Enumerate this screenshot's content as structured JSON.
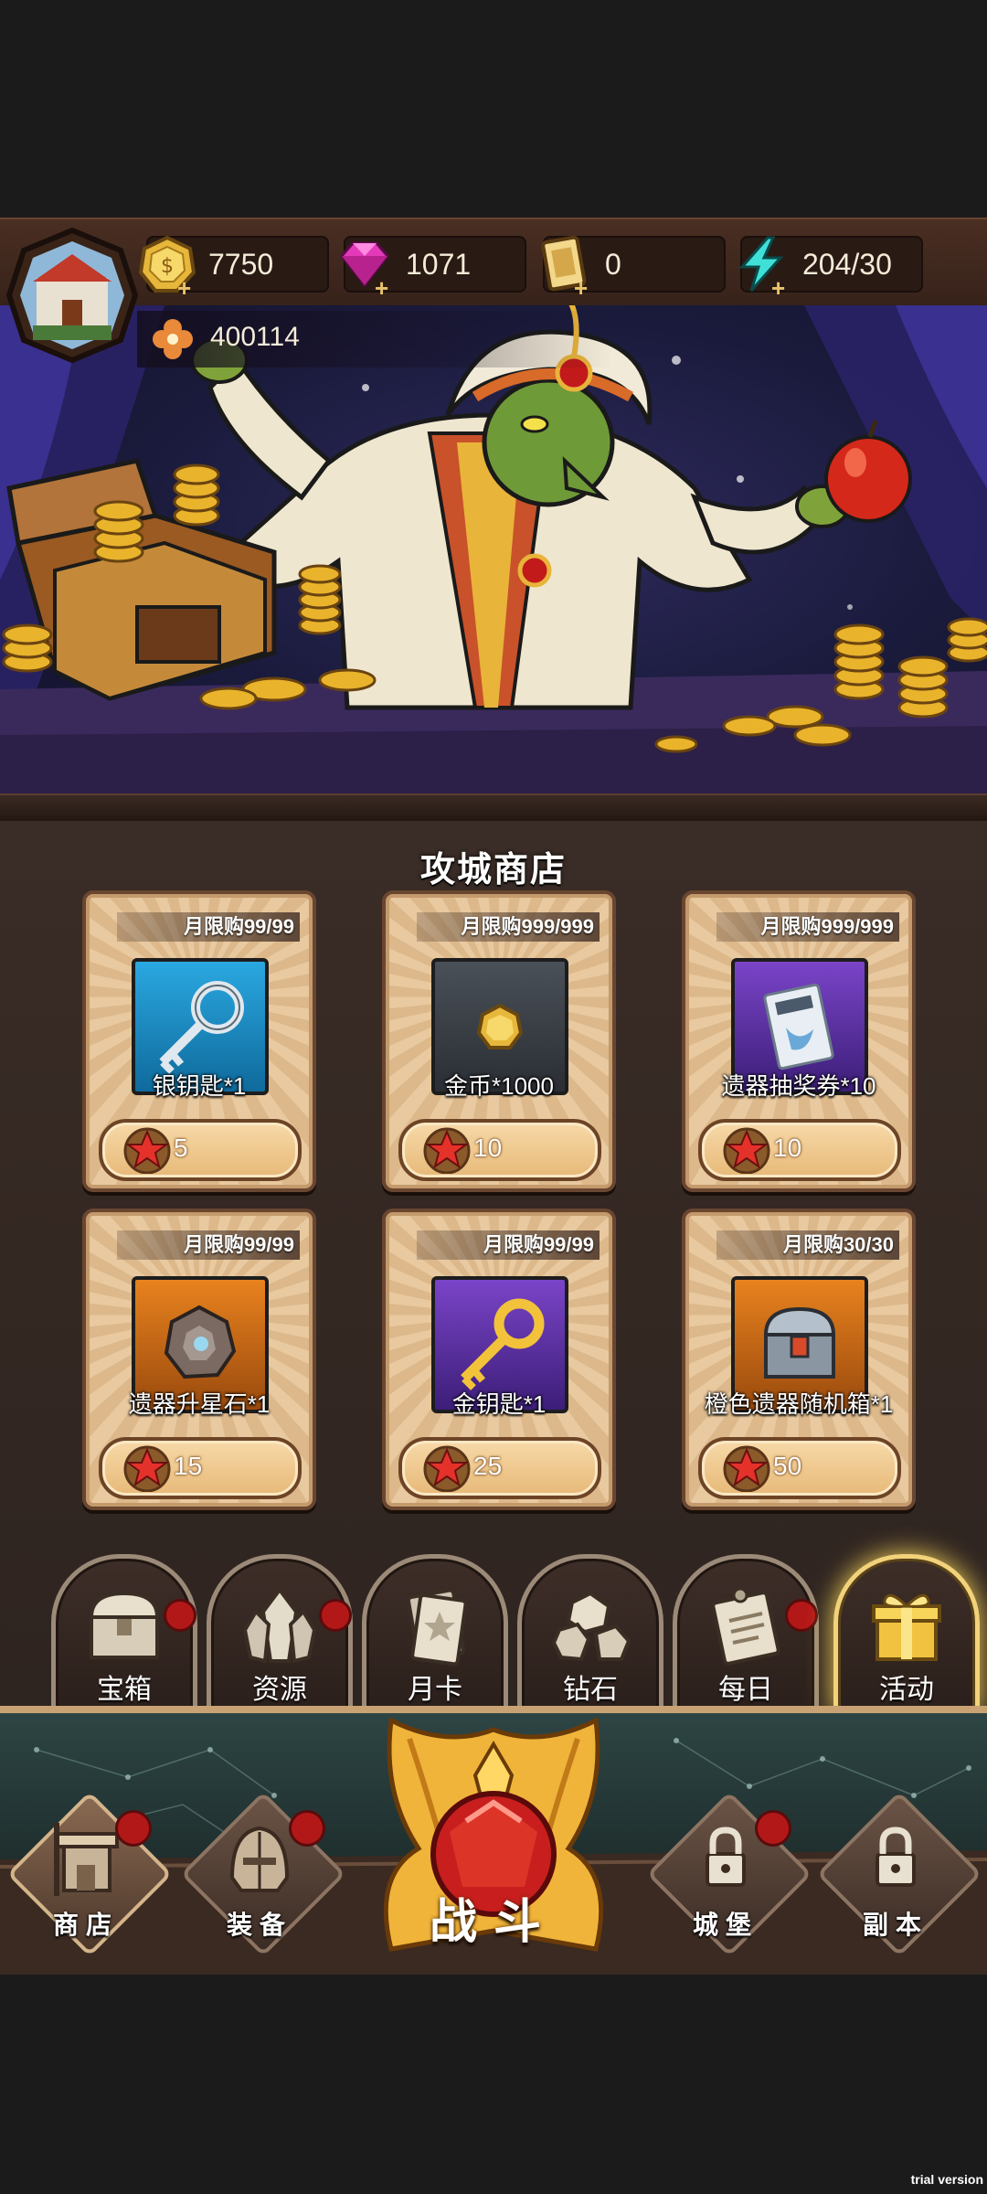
{
  "resources": {
    "gold": {
      "icon": "gold-coin-icon",
      "value": "7750"
    },
    "gems": {
      "icon": "diamond-icon",
      "value": "1071"
    },
    "tickets": {
      "icon": "ticket-icon",
      "value": "0"
    },
    "energy": {
      "icon": "lightning-icon",
      "value": "204/30"
    },
    "power": {
      "icon": "clover-icon",
      "value": "400114"
    },
    "plus_label": "+"
  },
  "shop": {
    "title": "攻城商店",
    "items": [
      {
        "limit": "月限购99/99",
        "name": "银钥匙*1",
        "price": "5",
        "icon": "silver-key-icon",
        "rarity": "blue"
      },
      {
        "limit": "月限购999/999",
        "name": "金币*1000",
        "price": "10",
        "icon": "gold-coin-icon",
        "rarity": "gray"
      },
      {
        "limit": "月限购999/999",
        "name": "遗器抽奖券*10",
        "price": "10",
        "icon": "ticket-icon",
        "rarity": "purple"
      },
      {
        "limit": "月限购99/99",
        "name": "遗器升星石*1",
        "price": "15",
        "icon": "star-stone-icon",
        "rarity": "orange"
      },
      {
        "limit": "月限购99/99",
        "name": "金钥匙*1",
        "price": "25",
        "icon": "gold-key-icon",
        "rarity": "purple"
      },
      {
        "limit": "月限购30/30",
        "name": "橙色遗器随机箱*1",
        "price": "50",
        "icon": "chest-icon",
        "rarity": "orange"
      }
    ]
  },
  "categories": [
    {
      "label": "宝箱",
      "icon": "chest-icon",
      "alert": true,
      "active": false
    },
    {
      "label": "资源",
      "icon": "crystal-icon",
      "alert": true,
      "active": false
    },
    {
      "label": "月卡",
      "icon": "card-icon",
      "alert": false,
      "active": false
    },
    {
      "label": "钻石",
      "icon": "diamond-icon",
      "alert": false,
      "active": false
    },
    {
      "label": "每日",
      "icon": "calendar-icon",
      "alert": true,
      "active": false
    },
    {
      "label": "活动",
      "icon": "gift-icon",
      "alert": false,
      "active": true
    }
  ],
  "nav": {
    "shop": "商店",
    "equipment": "装备",
    "battle": "战斗",
    "castle": "城堡",
    "dungeon": "副本"
  },
  "watermark": "trial version",
  "colors": {
    "rarity_blue": "#1c8fd0",
    "rarity_gray": "#3a3f44",
    "rarity_purple": "#5a2d9e",
    "rarity_orange": "#d9701a",
    "alert_red": "#b31818",
    "active_glow": "#f7d45a"
  }
}
